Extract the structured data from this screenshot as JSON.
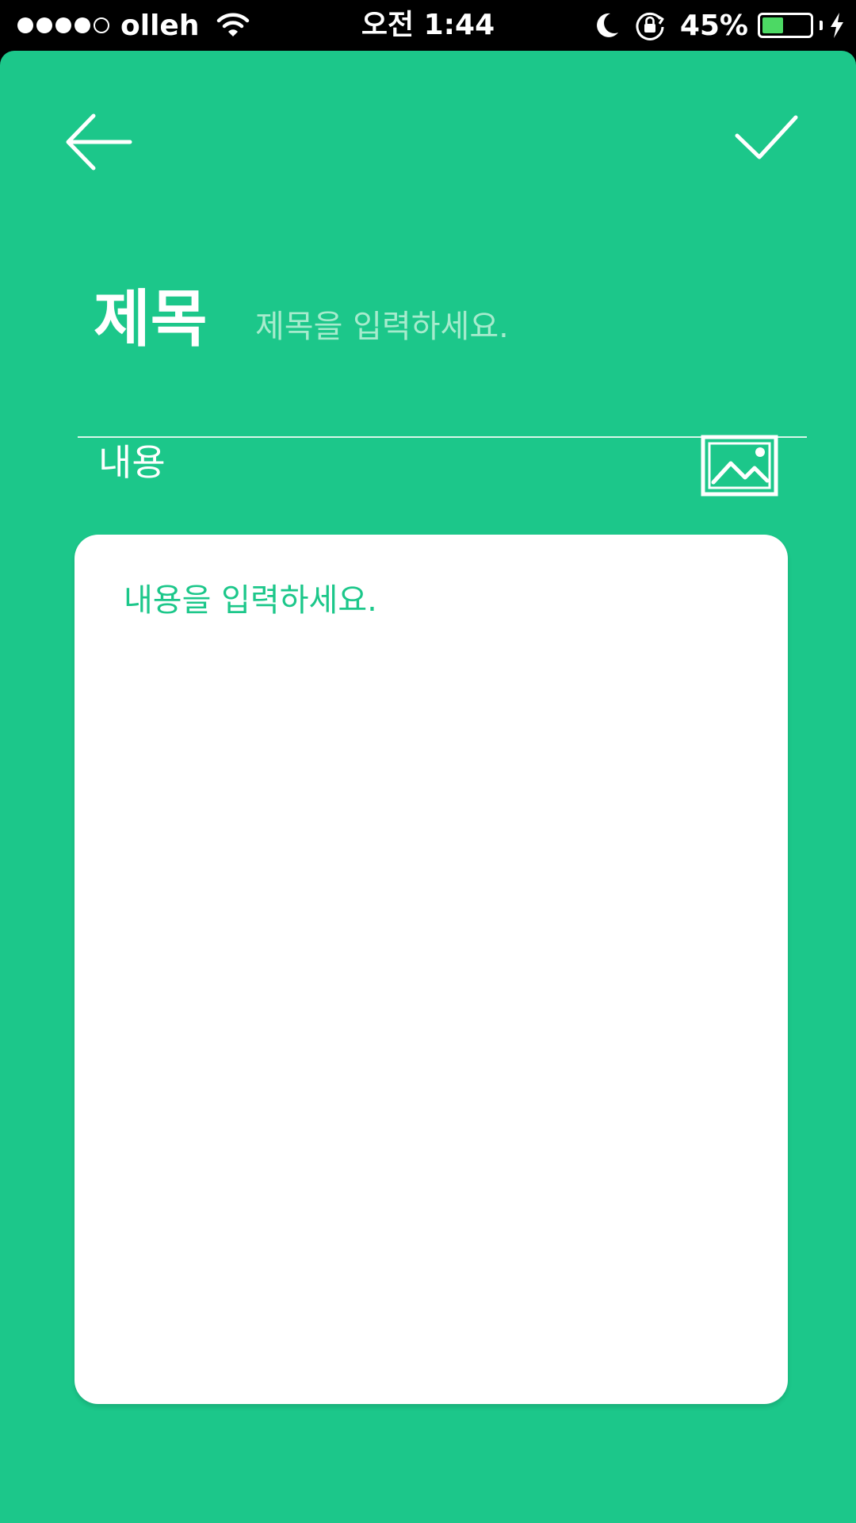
{
  "status_bar": {
    "carrier": "olleh",
    "signal_bars_filled": 4,
    "signal_bars_total": 5,
    "time": "오전 1:44",
    "battery_percent": "45%",
    "battery_level": 0.45,
    "icons": [
      "wifi-icon",
      "moon-icon",
      "rotation-lock-icon",
      "battery-icon",
      "charging-bolt-icon"
    ]
  },
  "header": {
    "back_icon": "arrow-left-icon",
    "confirm_icon": "checkmark-icon"
  },
  "form": {
    "title_label": "제목",
    "title_placeholder": "제목을 입력하세요.",
    "title_value": "",
    "content_label": "내용",
    "content_placeholder": "내용을 입력하세요.",
    "content_value": "",
    "image_icon": "image-icon"
  },
  "colors": {
    "background": "#1cc78a",
    "card": "#ffffff",
    "placeholder_on_green": "#a6ebcd",
    "battery": "#4cd964"
  }
}
